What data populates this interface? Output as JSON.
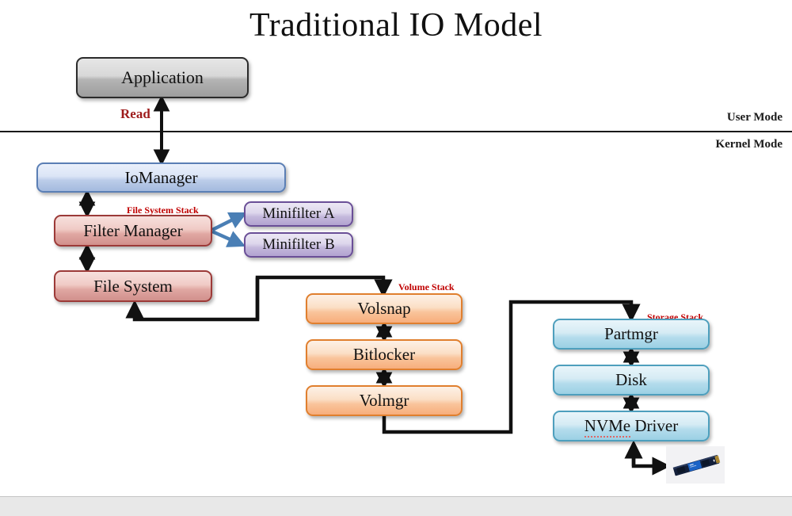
{
  "slide": {
    "title": "Traditional IO Model"
  },
  "mode_labels": {
    "user": "User Mode",
    "kernel": "Kernel Mode"
  },
  "annotations": {
    "read": "Read",
    "file_system_stack": "File System Stack",
    "volume_stack": "Volume Stack",
    "storage_stack": "Storage Stack"
  },
  "boxes": {
    "application": "Application",
    "iomanager": "IoManager",
    "filter_manager": "Filter Manager",
    "minifilter_a": "Minifilter A",
    "minifilter_b": "Minifilter B",
    "file_system": "File System",
    "volsnap": "Volsnap",
    "bitlocker": "Bitlocker",
    "volmgr": "Volmgr",
    "partmgr": "Partmgr",
    "disk": "Disk",
    "nvme_driver_prefix": "NVMe",
    "nvme_driver_suffix": " Driver"
  },
  "icons": {
    "ssd": "nvme-ssd-device-image"
  },
  "colors": {
    "accent_red": "#c00000",
    "read_label": "#9e1b1b",
    "gray_box_border": "#2b2b2b",
    "blue_box_border": "#5b7fb5",
    "red_box_border": "#9c3a38",
    "purple_box_border": "#6a4f97",
    "orange_box_border": "#e07f2e",
    "cyan_box_border": "#4e9fbd",
    "minifilter_arrow": "#4a7fb5",
    "connector": "#111111",
    "background": "#ffffff",
    "chrome": "#e8e8e8"
  }
}
